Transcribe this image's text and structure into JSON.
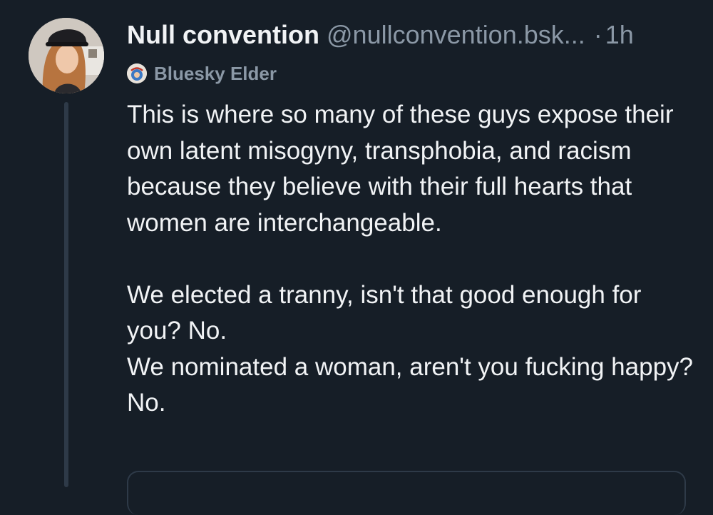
{
  "post": {
    "author": {
      "display_name": "Null convention",
      "handle": "@nullconvention.bsk...",
      "separator": "·",
      "time": "1h",
      "avatar_icon": "profile-photo"
    },
    "badge": {
      "icon": "bluesky-elder-badge-icon",
      "label": "Bluesky Elder"
    },
    "text_paragraphs": [
      "This is where so many of these guys expose their own latent misogyny, transphobia, and racism because they believe with their full hearts that women are interchangeable.",
      "We elected a tranny, isn't that good enough for you? No.",
      "We nominated a woman, aren't you fucking happy? No."
    ]
  },
  "colors": {
    "background": "#161e27",
    "text": "#f1f3f5",
    "muted": "#8b98a6",
    "thread_line": "#2e3a48"
  }
}
